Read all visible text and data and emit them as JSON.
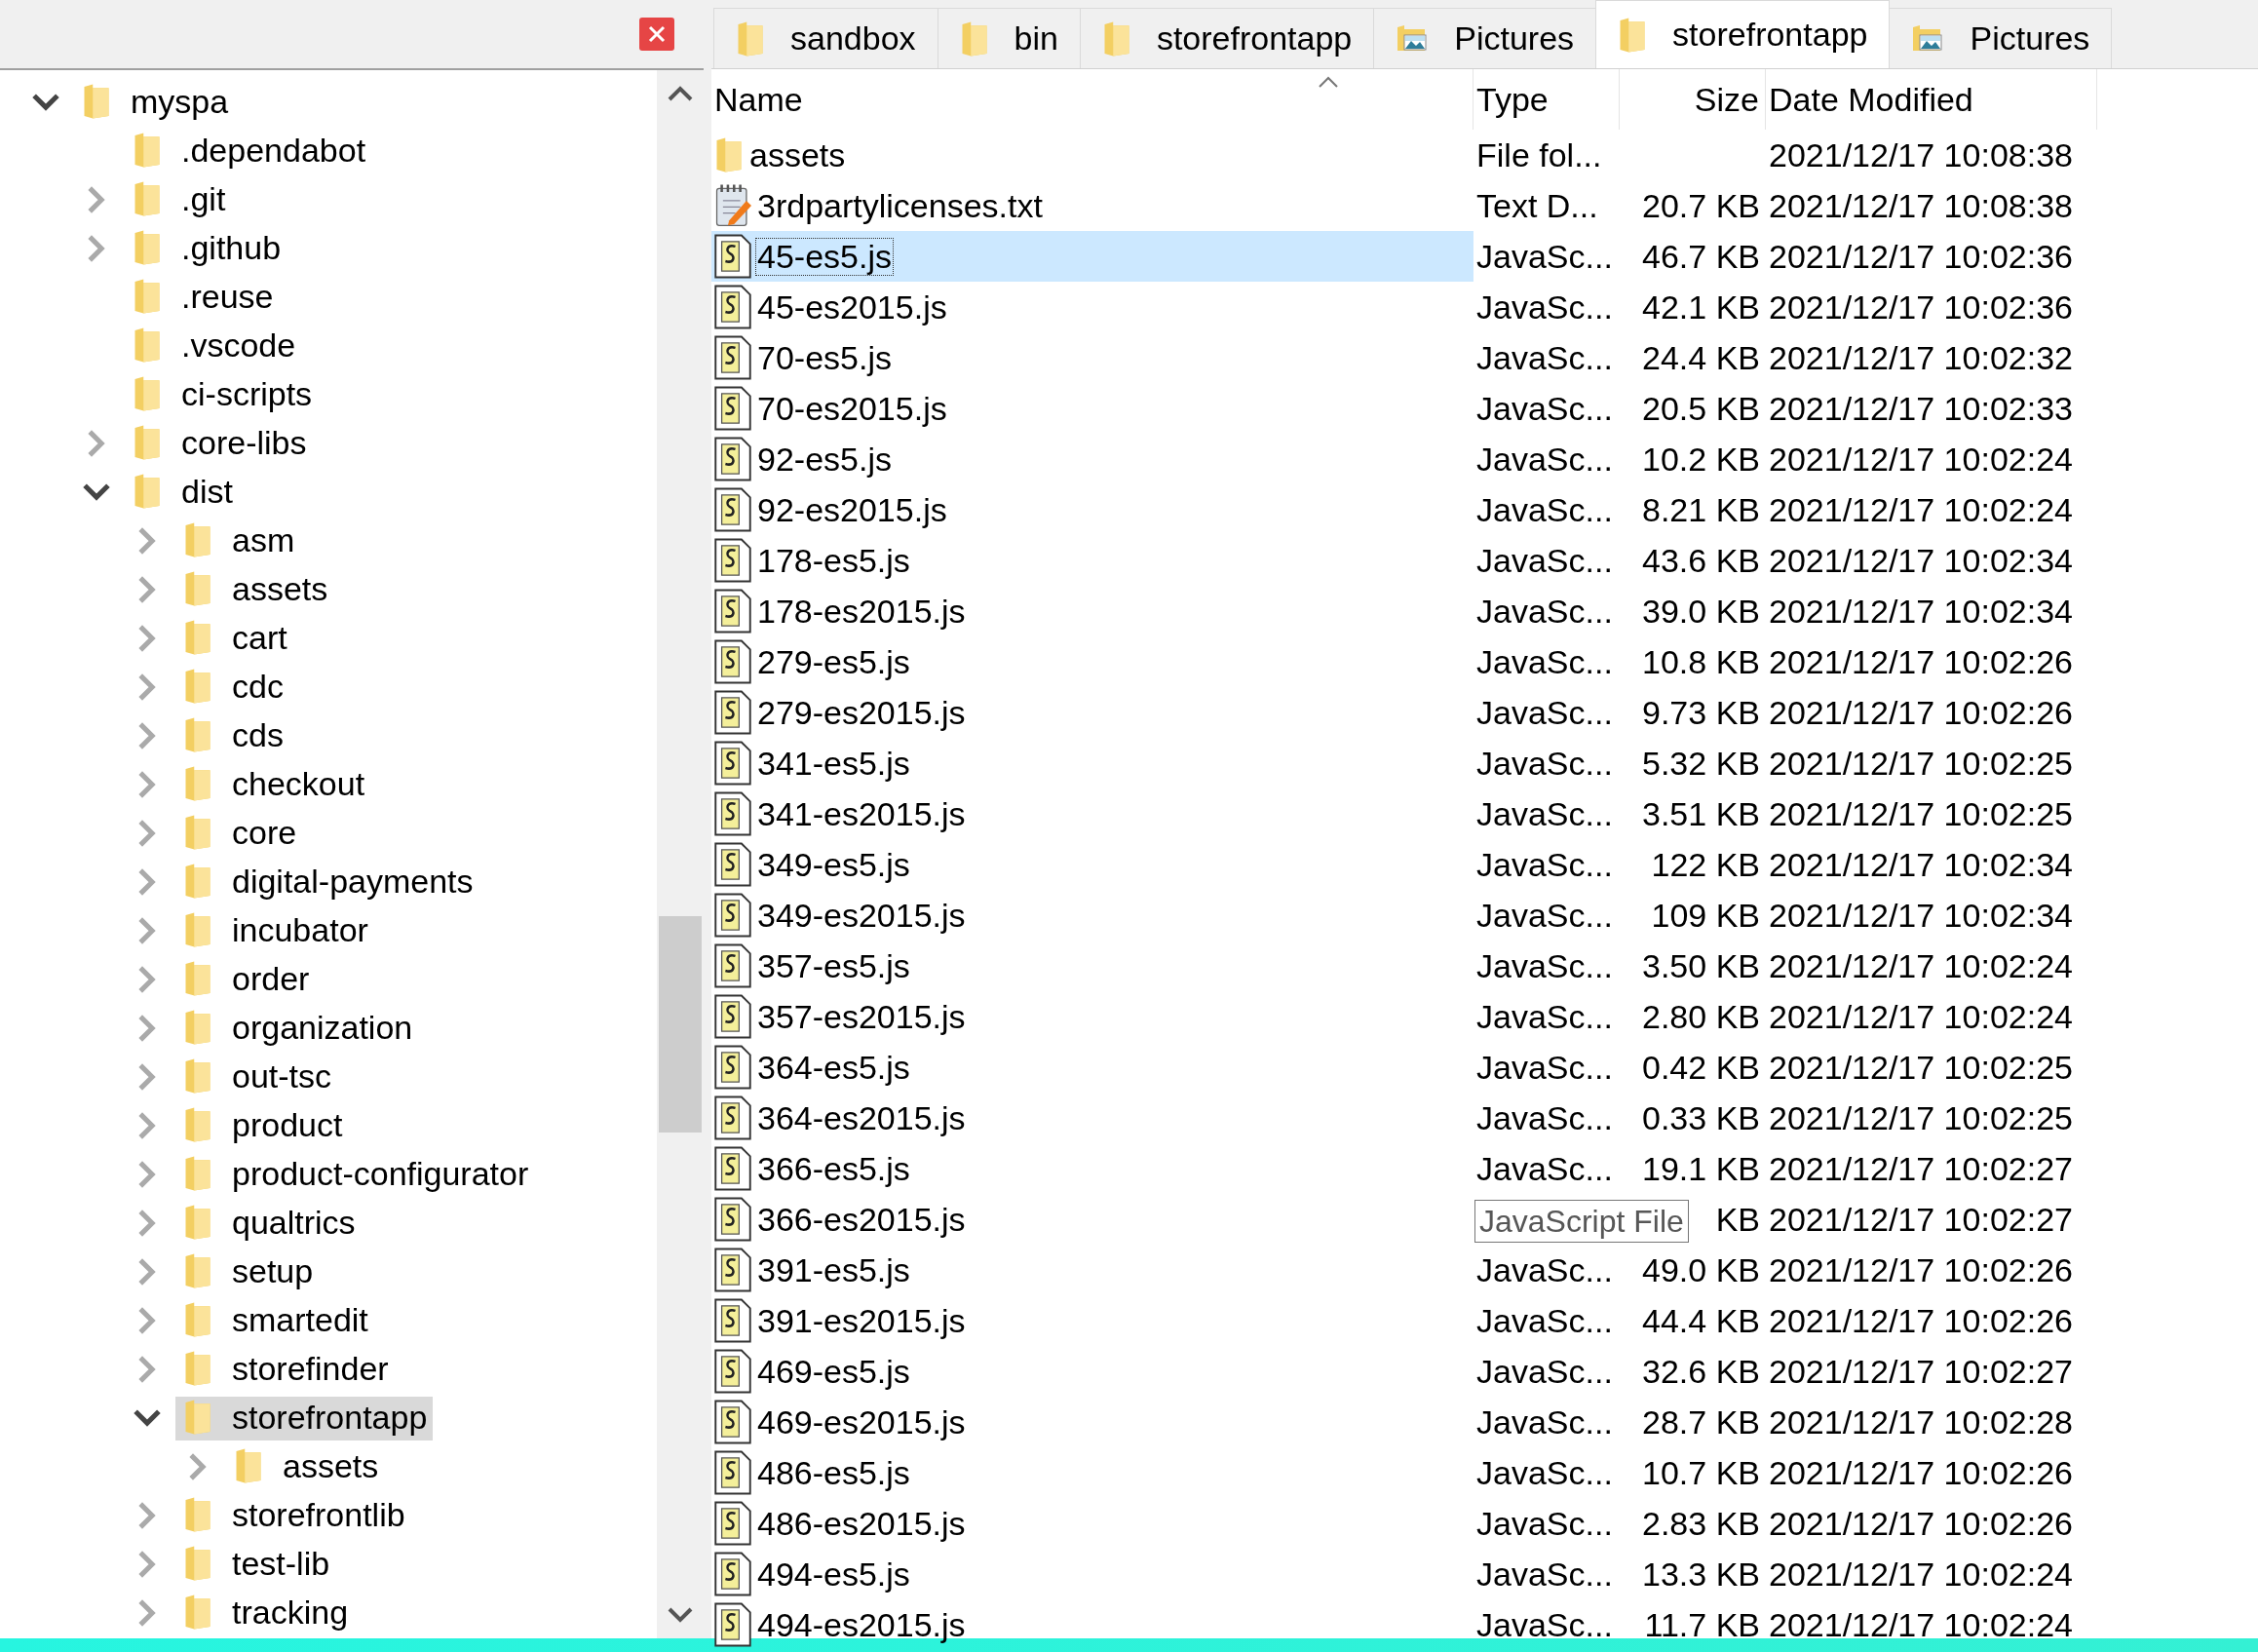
{
  "tree": [
    {
      "label": "myspa",
      "expandable": true,
      "expanded": true,
      "selected": false,
      "children": [
        {
          "label": ".dependabot",
          "expandable": false,
          "selected": false
        },
        {
          "label": ".git",
          "expandable": true,
          "expanded": false,
          "selected": false
        },
        {
          "label": ".github",
          "expandable": true,
          "expanded": false,
          "selected": false
        },
        {
          "label": ".reuse",
          "expandable": false,
          "selected": false
        },
        {
          "label": ".vscode",
          "expandable": false,
          "selected": false
        },
        {
          "label": "ci-scripts",
          "expandable": false,
          "selected": false
        },
        {
          "label": "core-libs",
          "expandable": true,
          "expanded": false,
          "selected": false
        },
        {
          "label": "dist",
          "expandable": true,
          "expanded": true,
          "selected": false,
          "children": [
            {
              "label": "asm",
              "expandable": true,
              "expanded": false,
              "selected": false
            },
            {
              "label": "assets",
              "expandable": true,
              "expanded": false,
              "selected": false
            },
            {
              "label": "cart",
              "expandable": true,
              "expanded": false,
              "selected": false
            },
            {
              "label": "cdc",
              "expandable": true,
              "expanded": false,
              "selected": false
            },
            {
              "label": "cds",
              "expandable": true,
              "expanded": false,
              "selected": false
            },
            {
              "label": "checkout",
              "expandable": true,
              "expanded": false,
              "selected": false
            },
            {
              "label": "core",
              "expandable": true,
              "expanded": false,
              "selected": false
            },
            {
              "label": "digital-payments",
              "expandable": true,
              "expanded": false,
              "selected": false
            },
            {
              "label": "incubator",
              "expandable": true,
              "expanded": false,
              "selected": false
            },
            {
              "label": "order",
              "expandable": true,
              "expanded": false,
              "selected": false
            },
            {
              "label": "organization",
              "expandable": true,
              "expanded": false,
              "selected": false
            },
            {
              "label": "out-tsc",
              "expandable": true,
              "expanded": false,
              "selected": false
            },
            {
              "label": "product",
              "expandable": true,
              "expanded": false,
              "selected": false
            },
            {
              "label": "product-configurator",
              "expandable": true,
              "expanded": false,
              "selected": false
            },
            {
              "label": "qualtrics",
              "expandable": true,
              "expanded": false,
              "selected": false
            },
            {
              "label": "setup",
              "expandable": true,
              "expanded": false,
              "selected": false
            },
            {
              "label": "smartedit",
              "expandable": true,
              "expanded": false,
              "selected": false
            },
            {
              "label": "storefinder",
              "expandable": true,
              "expanded": false,
              "selected": false
            },
            {
              "label": "storefrontapp",
              "expandable": true,
              "expanded": true,
              "selected": true,
              "children": [
                {
                  "label": "assets",
                  "expandable": true,
                  "expanded": false,
                  "selected": false
                }
              ]
            },
            {
              "label": "storefrontlib",
              "expandable": true,
              "expanded": false,
              "selected": false
            },
            {
              "label": "test-lib",
              "expandable": true,
              "expanded": false,
              "selected": false
            },
            {
              "label": "tracking",
              "expandable": true,
              "expanded": false,
              "selected": false
            }
          ]
        }
      ]
    }
  ],
  "tabs": [
    {
      "label": "sandbox",
      "kind": "folder",
      "selected": false
    },
    {
      "label": "bin",
      "kind": "folder",
      "selected": false
    },
    {
      "label": "storefrontapp",
      "kind": "folder",
      "selected": false
    },
    {
      "label": "Pictures",
      "kind": "pictures",
      "selected": false
    },
    {
      "label": "storefrontapp",
      "kind": "folder",
      "selected": true
    },
    {
      "label": "Pictures",
      "kind": "pictures",
      "selected": false
    }
  ],
  "table": {
    "columns": [
      "Name",
      "Type",
      "Size",
      "Date Modified"
    ],
    "rows": [
      {
        "kind": "folder",
        "name": "assets",
        "type": "File fol...",
        "modified": "2021/12/17 10:08:38",
        "selected": false
      },
      {
        "kind": "text",
        "name": "3rdpartylicenses.txt",
        "type": "Text D...",
        "size": "20.7 KB",
        "modified": "2021/12/17 10:08:38",
        "selected": false
      },
      {
        "kind": "script",
        "name": "45-es5.js",
        "type": "JavaSc...",
        "size": "46.7 KB",
        "modified": "2021/12/17 10:02:36",
        "selected": true
      },
      {
        "kind": "script",
        "name": "45-es2015.js",
        "type": "JavaSc...",
        "size": "42.1 KB",
        "modified": "2021/12/17 10:02:36",
        "selected": false
      },
      {
        "kind": "script",
        "name": "70-es5.js",
        "type": "JavaSc...",
        "size": "24.4 KB",
        "modified": "2021/12/17 10:02:32",
        "selected": false
      },
      {
        "kind": "script",
        "name": "70-es2015.js",
        "type": "JavaSc...",
        "size": "20.5 KB",
        "modified": "2021/12/17 10:02:33",
        "selected": false
      },
      {
        "kind": "script",
        "name": "92-es5.js",
        "type": "JavaSc...",
        "size": "10.2 KB",
        "modified": "2021/12/17 10:02:24",
        "selected": false
      },
      {
        "kind": "script",
        "name": "92-es2015.js",
        "type": "JavaSc...",
        "size": "8.21 KB",
        "modified": "2021/12/17 10:02:24",
        "selected": false
      },
      {
        "kind": "script",
        "name": "178-es5.js",
        "type": "JavaSc...",
        "size": "43.6 KB",
        "modified": "2021/12/17 10:02:34",
        "selected": false
      },
      {
        "kind": "script",
        "name": "178-es2015.js",
        "type": "JavaSc...",
        "size": "39.0 KB",
        "modified": "2021/12/17 10:02:34",
        "selected": false
      },
      {
        "kind": "script",
        "name": "279-es5.js",
        "type": "JavaSc...",
        "size": "10.8 KB",
        "modified": "2021/12/17 10:02:26",
        "selected": false
      },
      {
        "kind": "script",
        "name": "279-es2015.js",
        "type": "JavaSc...",
        "size": "9.73 KB",
        "modified": "2021/12/17 10:02:26",
        "selected": false
      },
      {
        "kind": "script",
        "name": "341-es5.js",
        "type": "JavaSc...",
        "size": "5.32 KB",
        "modified": "2021/12/17 10:02:25",
        "selected": false
      },
      {
        "kind": "script",
        "name": "341-es2015.js",
        "type": "JavaSc...",
        "size": "3.51 KB",
        "modified": "2021/12/17 10:02:25",
        "selected": false
      },
      {
        "kind": "script",
        "name": "349-es5.js",
        "type": "JavaSc...",
        "size": "122 KB",
        "modified": "2021/12/17 10:02:34",
        "selected": false
      },
      {
        "kind": "script",
        "name": "349-es2015.js",
        "type": "JavaSc...",
        "size": "109 KB",
        "modified": "2021/12/17 10:02:34",
        "selected": false
      },
      {
        "kind": "script",
        "name": "357-es5.js",
        "type": "JavaSc...",
        "size": "3.50 KB",
        "modified": "2021/12/17 10:02:24",
        "selected": false
      },
      {
        "kind": "script",
        "name": "357-es2015.js",
        "type": "JavaSc...",
        "size": "2.80 KB",
        "modified": "2021/12/17 10:02:24",
        "selected": false
      },
      {
        "kind": "script",
        "name": "364-es5.js",
        "type": "JavaSc...",
        "size": "0.42 KB",
        "modified": "2021/12/17 10:02:25",
        "selected": false
      },
      {
        "kind": "script",
        "name": "364-es2015.js",
        "type": "JavaSc...",
        "size": "0.33 KB",
        "modified": "2021/12/17 10:02:25",
        "selected": false
      },
      {
        "kind": "script",
        "name": "366-es5.js",
        "type": "JavaSc...",
        "size": "19.1 KB",
        "modified": "2021/12/17 10:02:27",
        "selected": false
      },
      {
        "kind": "script",
        "name": "366-es2015.js",
        "tooltip": "JavaScript File",
        "size": "KB",
        "modified": "2021/12/17 10:02:27",
        "selected": false
      },
      {
        "kind": "script",
        "name": "391-es5.js",
        "type": "JavaSc...",
        "size": "49.0 KB",
        "modified": "2021/12/17 10:02:26",
        "selected": false
      },
      {
        "kind": "script",
        "name": "391-es2015.js",
        "type": "JavaSc...",
        "size": "44.4 KB",
        "modified": "2021/12/17 10:02:26",
        "selected": false
      },
      {
        "kind": "script",
        "name": "469-es5.js",
        "type": "JavaSc...",
        "size": "32.6 KB",
        "modified": "2021/12/17 10:02:27",
        "selected": false
      },
      {
        "kind": "script",
        "name": "469-es2015.js",
        "type": "JavaSc...",
        "size": "28.7 KB",
        "modified": "2021/12/17 10:02:28",
        "selected": false
      },
      {
        "kind": "script",
        "name": "486-es5.js",
        "type": "JavaSc...",
        "size": "10.7 KB",
        "modified": "2021/12/17 10:02:26",
        "selected": false
      },
      {
        "kind": "script",
        "name": "486-es2015.js",
        "type": "JavaSc...",
        "size": "2.83 KB",
        "modified": "2021/12/17 10:02:26",
        "selected": false
      },
      {
        "kind": "script",
        "name": "494-es5.js",
        "type": "JavaSc...",
        "size": "13.3 KB",
        "modified": "2021/12/17 10:02:24",
        "selected": false
      },
      {
        "kind": "script",
        "name": "494-es2015.js",
        "type": "JavaSc...",
        "size": "11.7 KB",
        "modified": "2021/12/17 10:02:24",
        "selected": false
      }
    ]
  }
}
